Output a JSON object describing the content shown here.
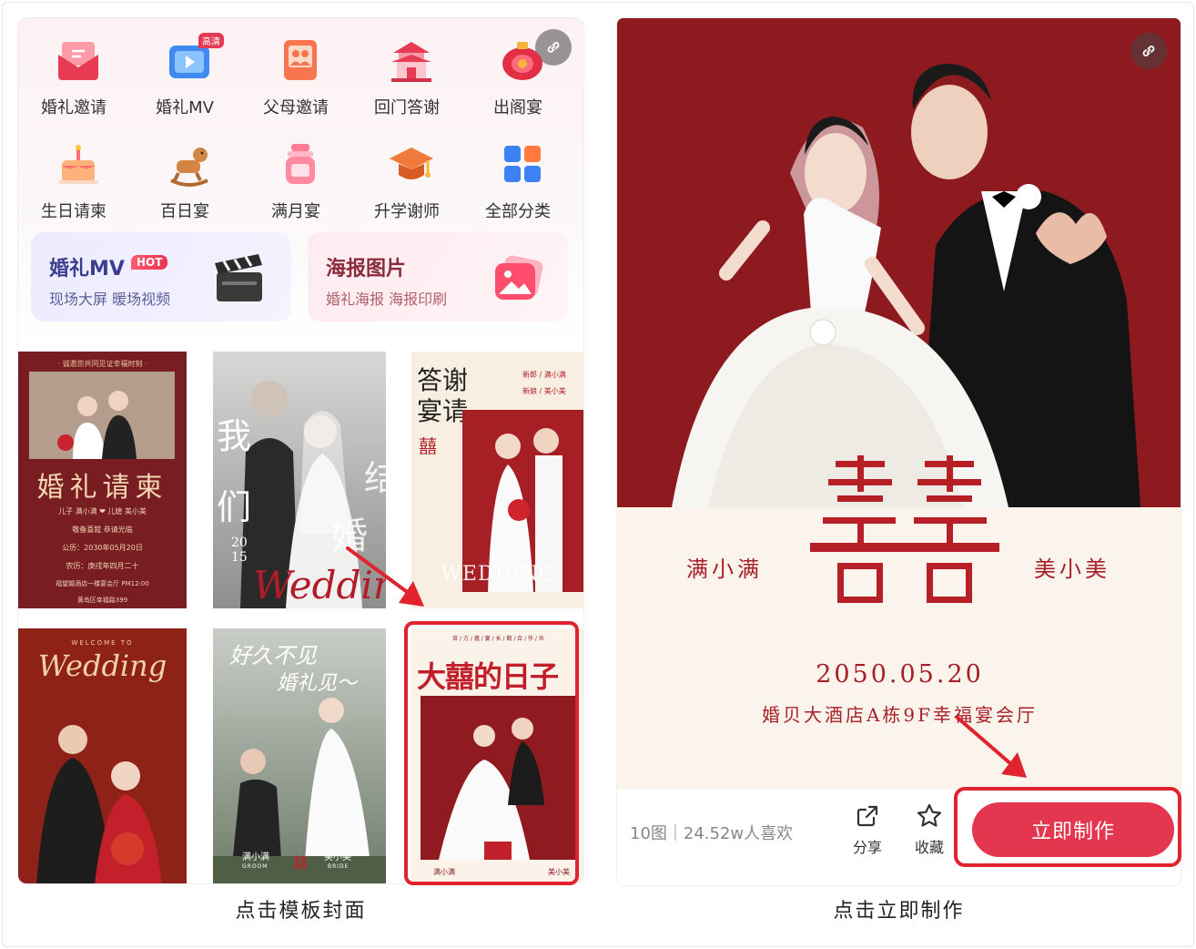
{
  "left": {
    "categories": [
      {
        "label": "婚礼邀请",
        "icon": "envelope-icon"
      },
      {
        "label": "婚礼MV",
        "icon": "video-icon",
        "badge": "高清"
      },
      {
        "label": "父母邀请",
        "icon": "parents-icon"
      },
      {
        "label": "回门答谢",
        "icon": "pavilion-icon"
      },
      {
        "label": "出阁宴",
        "icon": "red-lantern-icon"
      },
      {
        "label": "生日请柬",
        "icon": "cake-icon"
      },
      {
        "label": "百日宴",
        "icon": "rocking-horse-icon"
      },
      {
        "label": "满月宴",
        "icon": "baby-bottle-icon"
      },
      {
        "label": "升学谢师",
        "icon": "graduation-cap-icon"
      },
      {
        "label": "全部分类",
        "icon": "grid-icon"
      }
    ],
    "promo_mv": {
      "title": "婚礼MV",
      "hot": "HOT",
      "subtitle": "现场大屏 暖场视频"
    },
    "promo_poster": {
      "title": "海报图片",
      "subtitle": "婚礼海报 海报印刷"
    },
    "templates": {
      "t1": {
        "header": "· 诚邀您共同见证幸福时刻 ·",
        "title": "婚礼请柬",
        "groom_line": "儿子 满小满 ❤ 儿媳 美小美",
        "line1": "敬备喜筵 恭请光临",
        "line2": "公历：2030年05月20日",
        "line3": "农历：庚戌年四月二十",
        "line4": "福望婚酒店一楼宴会厅 PM12:00",
        "line5": "黄岛区幸福路399"
      },
      "t2": {
        "v1": "我",
        "v2": "们",
        "v3": "结",
        "v4": "婚",
        "year_top": "20",
        "year_bottom": "15",
        "script": "Wedding"
      },
      "t3": {
        "title_line1": "答谢",
        "title_line2": "宴请",
        "groom": "新郎 / 满小满",
        "bride": "新娘 / 美小美",
        "xi": "囍",
        "wedding": "WEDDING"
      },
      "t4": {
        "welcome": "WELCOME TO",
        "script": "Wedding"
      },
      "t5": {
        "line1": "好久不见",
        "line2": "婚礼见～",
        "groom": "满小满",
        "groom_en": "GROOM",
        "bride": "美小美",
        "bride_en": "BRIDE",
        "xi": "囍"
      },
      "t6": {
        "header": "官 / 方 / 邀 / 宴 / 长 / 期 / 合 / 作 / 伙",
        "title": "大囍的日子",
        "groom": "满小满",
        "bride": "美小美"
      }
    },
    "caption": "点击模板封面"
  },
  "right": {
    "groom": "满小满",
    "bride": "美小美",
    "date": "2050.05.20",
    "venue": "婚贝大酒店A栋9F幸福宴会厅",
    "stats": "10图｜24.52w人喜欢",
    "share_label": "分享",
    "favorite_label": "收藏",
    "make_button": "立即制作",
    "caption": "点击立即制作"
  },
  "colors": {
    "accent": "#e5364f",
    "highlight": "#e1222f",
    "wedding_red": "#a72027"
  }
}
